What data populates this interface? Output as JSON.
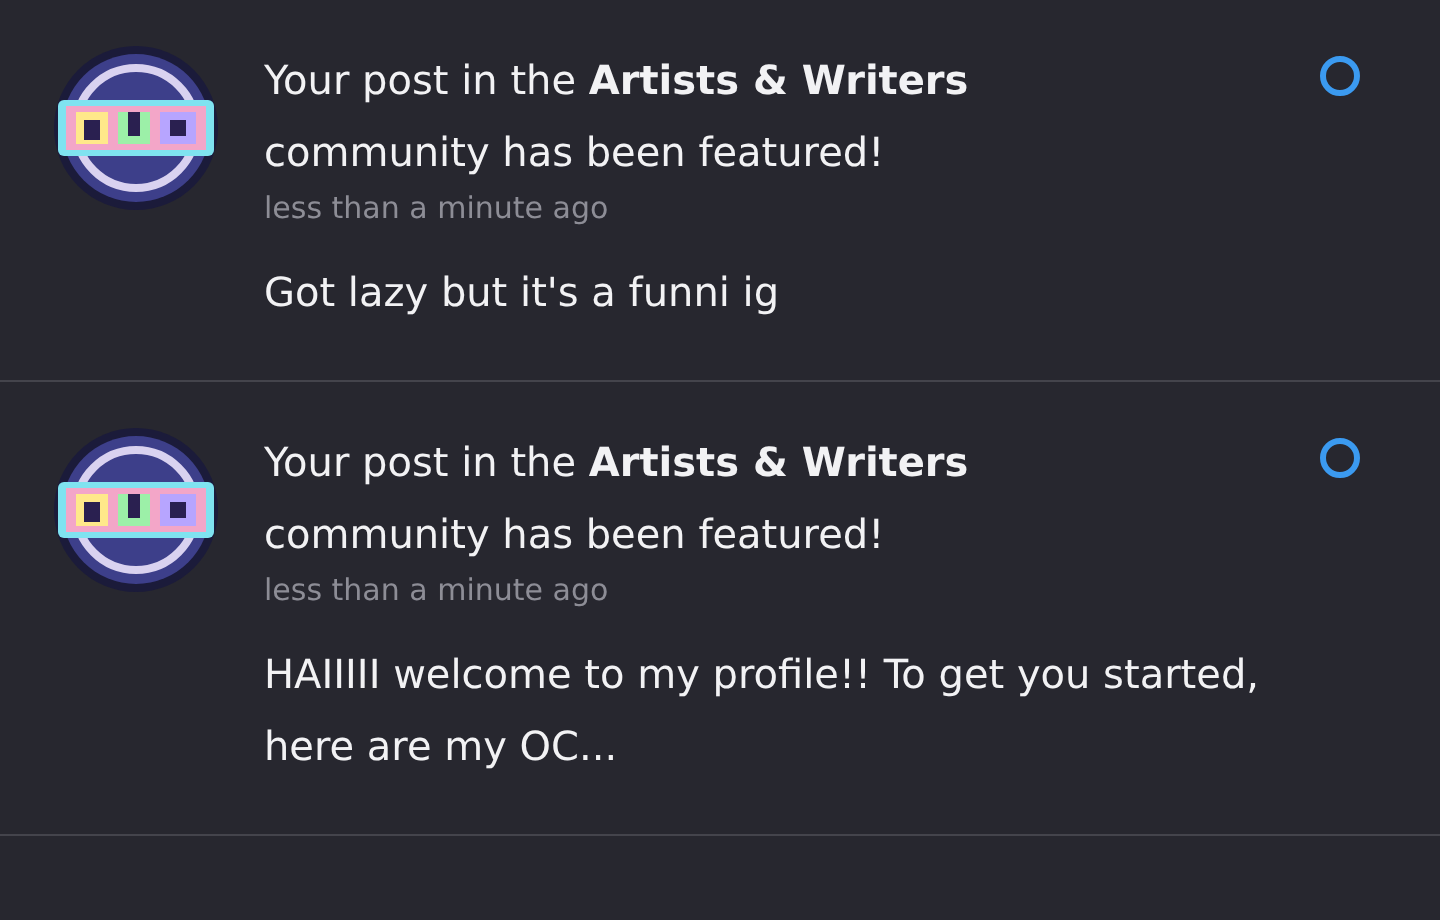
{
  "notifications": [
    {
      "title": "Your post in the **Artists & Writers** community has been featured!",
      "time": "less than a minute ago",
      "body": "Got lazy but it's a funni ig",
      "unread": true
    },
    {
      "title": "Your post in the **Artists & Writers** community has been featured!",
      "time": "less than a minute ago",
      "body": "HAIIIII welcome to my profile!! To get you started, here are my OC...",
      "unread": true
    }
  ]
}
